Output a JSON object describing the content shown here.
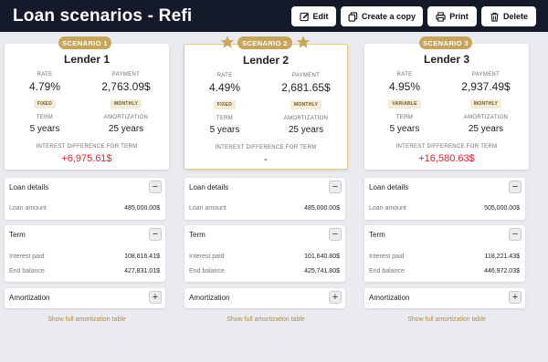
{
  "header": {
    "title": "Loan scenarios - Refi",
    "buttons": {
      "edit": "Edit",
      "copy": "Create a copy",
      "print": "Print",
      "delete": "Delete"
    }
  },
  "labels": {
    "rate": "RATE",
    "payment": "PAYMENT",
    "term": "TERM",
    "amortization": "AMORTIZATION",
    "interest_difference": "INTEREST DIFFERENCE FOR TERM",
    "loan_details": "Loan details",
    "loan_amount": "Loan amount",
    "term_section": "Term",
    "interest_paid": "Interest paid",
    "end_balance": "End balance",
    "amortization_section": "Amortization",
    "show_table": "Show full amortization table",
    "minus": "−",
    "plus": "+"
  },
  "scenarios": [
    {
      "badge": "SCENARIO 1",
      "lender": "Lender 1",
      "rate": "4.79%",
      "rate_type": "FIXED",
      "payment": "2,763.09$",
      "payment_freq": "MONTHLY",
      "term": "5 years",
      "amortization": "25 years",
      "interest_difference": "+6,975.61$",
      "loan_amount": "485,000.00$",
      "interest_paid": "108,616.41$",
      "end_balance": "427,831.01$"
    },
    {
      "badge": "SCENARIO 2",
      "lender": "Lender 2",
      "rate": "4.49%",
      "rate_type": "FIXED",
      "payment": "2,681.65$",
      "payment_freq": "MONTHLY",
      "term": "5 years",
      "amortization": "25 years",
      "interest_difference": "-",
      "loan_amount": "485,000.00$",
      "interest_paid": "101,640.80$",
      "end_balance": "425,741.80$"
    },
    {
      "badge": "SCENARIO 3",
      "lender": "Lender 3",
      "rate": "4.95%",
      "rate_type": "VARIABLE",
      "payment": "2,937.49$",
      "payment_freq": "MONTHLY",
      "term": "5 years",
      "amortization": "25 years",
      "interest_difference": "+16,580.63$",
      "loan_amount": "505,000.00$",
      "interest_paid": "118,221.43$",
      "end_balance": "446,972.03$"
    }
  ],
  "colors": {
    "header_bg": "#151a2b",
    "badge_gold": "#c7a55a",
    "selected_border": "#e6cf7c",
    "difference_red": "#e8202a",
    "link_gold": "#b08d3e"
  }
}
